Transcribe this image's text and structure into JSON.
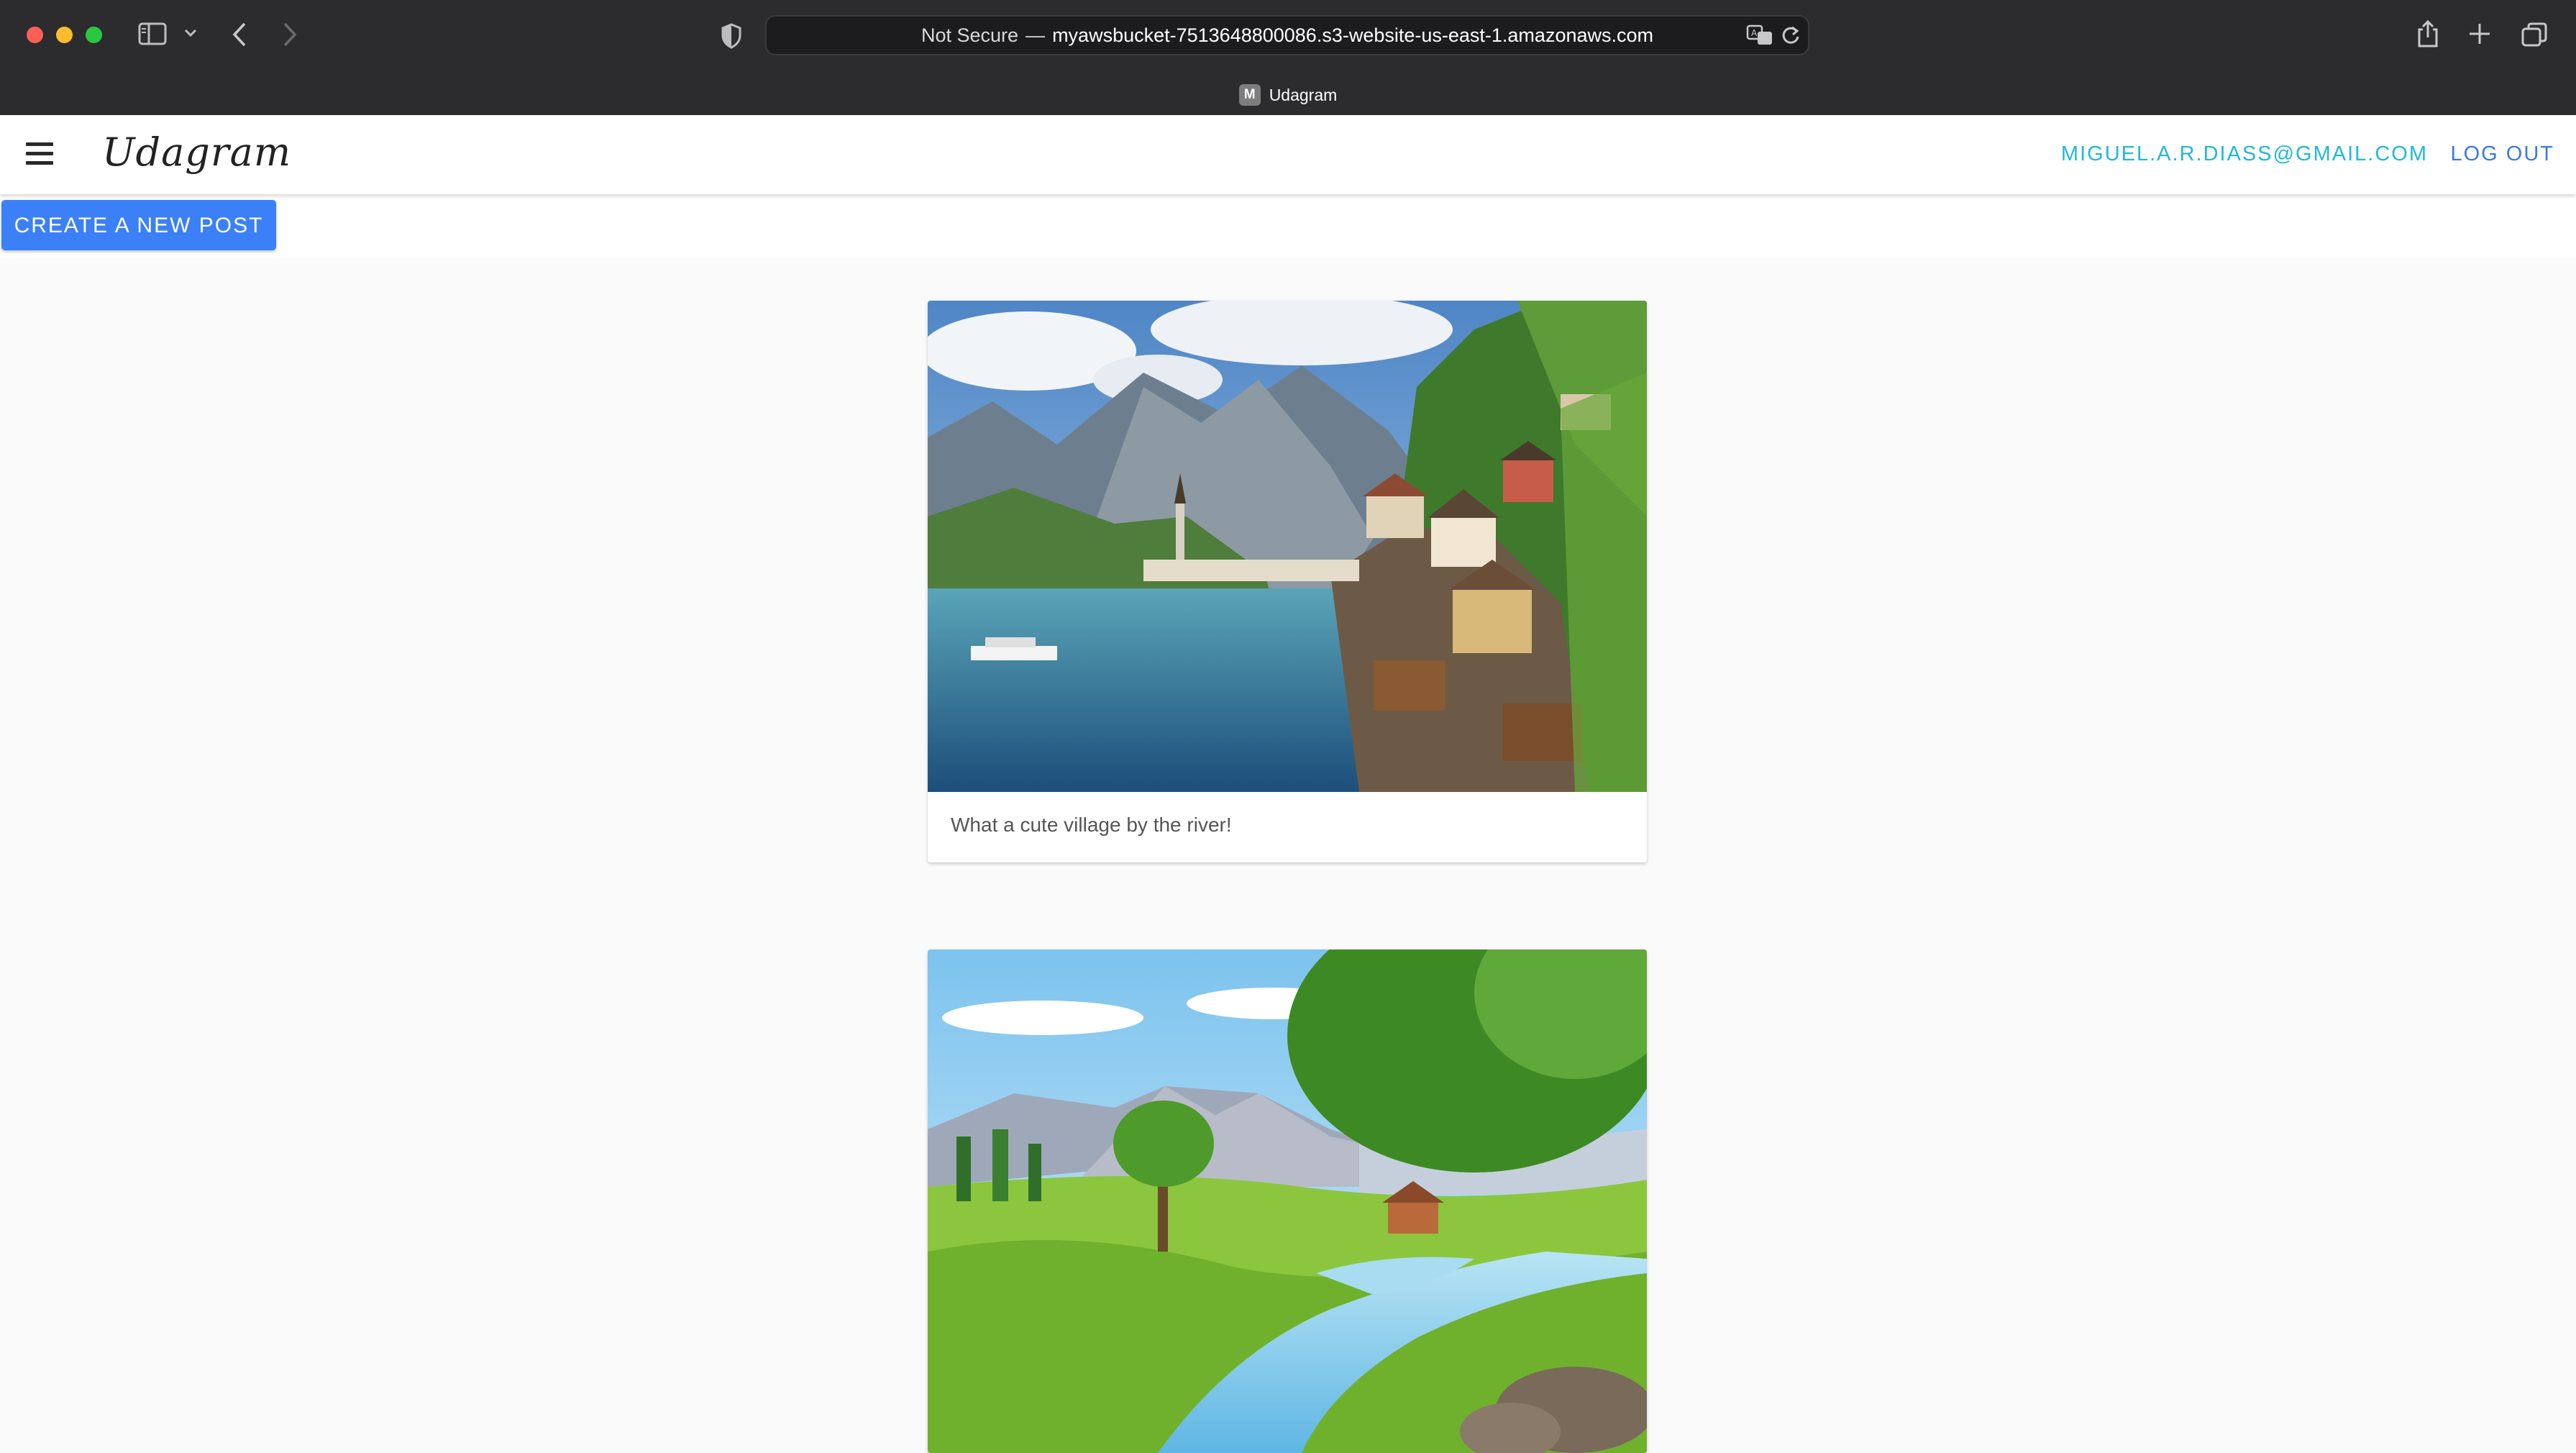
{
  "browser": {
    "url_prefix": "Not Secure",
    "url_separator": "—",
    "url_domain": "myawsbucket-7513648800086.s3-website-us-east-1.amazonaws.com",
    "tab_title": "Udagram",
    "tab_favicon_letter": "M"
  },
  "header": {
    "brand": "Udagram",
    "user_email": "MIGUEL.A.R.DIASS@GMAIL.COM",
    "logout_label": "LOG OUT"
  },
  "toolbar": {
    "create_label": "CREATE A NEW POST"
  },
  "feed": {
    "posts": [
      {
        "caption": "What a cute village by the river!"
      },
      {
        "caption": ""
      }
    ]
  },
  "colors": {
    "accent": "#3b80f7",
    "user_link": "#21b8d8",
    "logout_link": "#3c78e8",
    "chrome_bg": "#2c2c2e"
  }
}
